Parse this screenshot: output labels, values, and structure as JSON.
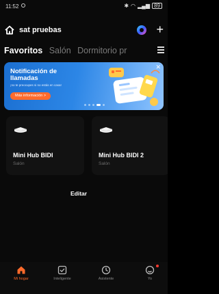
{
  "status_bar": {
    "time": "11:52",
    "battery": "89"
  },
  "header": {
    "home_name": "sat pruebas",
    "icons": [
      "home-icon",
      "assistant-icon",
      "plus-icon"
    ]
  },
  "tabs": [
    {
      "label": "Favoritos",
      "active": true
    },
    {
      "label": "Salón",
      "active": false
    },
    {
      "label": "Dormitorio pr",
      "active": false
    }
  ],
  "banner": {
    "title": "Notificación de llamadas",
    "subtitle": "¡no te preocupes si no estás en casa!",
    "button": "Más información >",
    "accent": "#ff6b2c"
  },
  "devices": [
    {
      "name": "Mini Hub BIDI",
      "room": "Salón",
      "icon": "hub-icon"
    },
    {
      "name": "Mini Hub BIDI 2",
      "room": "Salón",
      "icon": "hub-icon"
    }
  ],
  "edit_label": "Editar",
  "nav": [
    {
      "label": "Mi hogar",
      "icon": "home-icon",
      "active": true
    },
    {
      "label": "Inteligente",
      "icon": "checkbox-icon",
      "active": false
    },
    {
      "label": "Asistente",
      "icon": "compass-icon",
      "active": false
    },
    {
      "label": "Yo",
      "icon": "profile-icon",
      "active": false
    }
  ],
  "colors": {
    "accent": "#ff6a2b",
    "background": "#0a0a0a",
    "card": "#121212"
  }
}
